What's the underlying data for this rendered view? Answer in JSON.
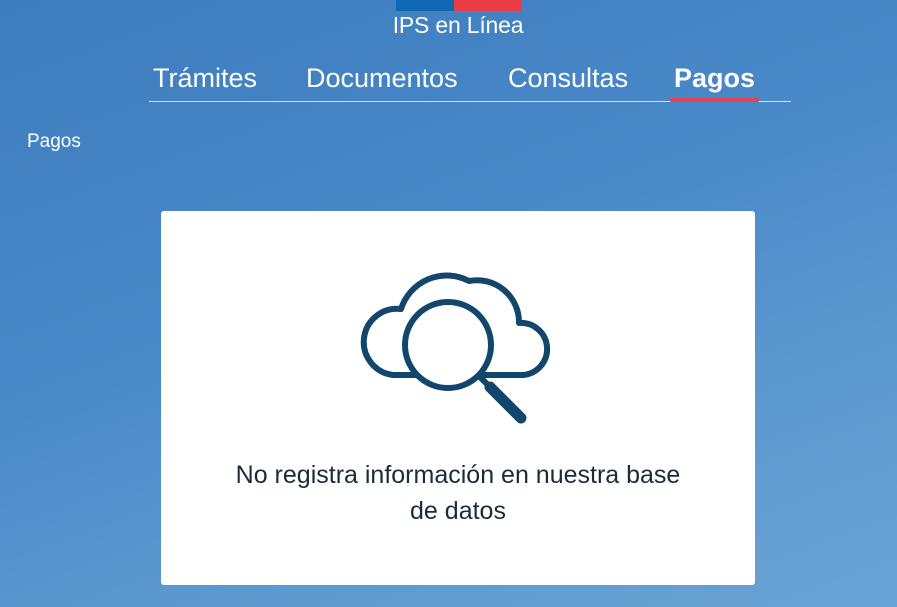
{
  "header": {
    "title": "IPS en Línea",
    "flag_colors": [
      "#0f69b4",
      "#eb3c46"
    ]
  },
  "nav": {
    "tabs": [
      {
        "label": "Trámites",
        "active": false
      },
      {
        "label": "Documentos",
        "active": false
      },
      {
        "label": "Consultas",
        "active": false
      },
      {
        "label": "Pagos",
        "active": true
      }
    ],
    "active_indicator_color": "#e04456"
  },
  "breadcrumb": {
    "current": "Pagos"
  },
  "main": {
    "empty_state": {
      "icon": "cloud-search-icon",
      "message_line1": "No registra información en nuestra base",
      "message_line2": "de datos"
    }
  },
  "colors": {
    "background": "#4a8ac9",
    "icon_stroke": "#12466b",
    "text": "#1c2b3a"
  }
}
